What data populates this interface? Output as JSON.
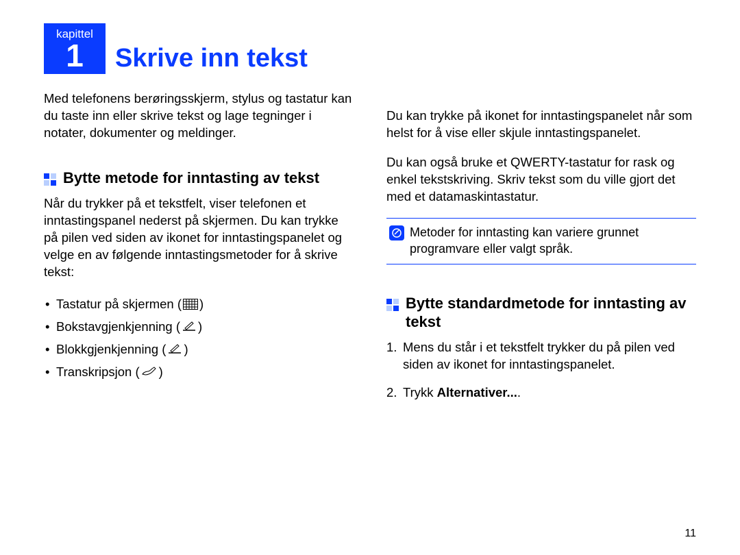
{
  "chapter": {
    "label": "kapittel",
    "number": "1",
    "title": "Skrive inn tekst"
  },
  "intro": "Med telefonens berøringsskjerm, stylus og tastatur kan du taste inn eller skrive tekst og lage tegninger i notater, dokumenter og meldinger.",
  "section1": {
    "title": "Bytte metode for inntasting av tekst",
    "body": "Når du trykker på et tekstfelt, viser telefonen et inntastingspanel nederst på skjermen. Du kan trykke på pilen ved siden av ikonet for inntastingspanelet og velge en av følgende inntastingsmetoder for å skrive tekst:",
    "items": [
      {
        "label": "Tastatur på skjermen (",
        "icon": "keyboard",
        "close": ")"
      },
      {
        "label": "Bokstavgjenkjenning (",
        "icon": "pen",
        "close": ")"
      },
      {
        "label": "Blokkgjenkjenning (",
        "icon": "pen",
        "close": ")"
      },
      {
        "label": "Transkripsjon (",
        "icon": "hand",
        "close": ")"
      }
    ]
  },
  "col2": {
    "p1": "Du kan trykke på ikonet for inntastingspanelet når som helst for å vise eller skjule inntastingspanelet.",
    "p2": "Du kan også bruke et QWERTY-tastatur for rask og enkel tekstskriving. Skriv tekst som du ville gjort det med et datamaskintastatur.",
    "note": "Metoder for inntasting kan variere grunnet programvare eller valgt språk."
  },
  "section2": {
    "title": "Bytte standardmetode for inntasting av tekst",
    "steps": [
      {
        "text": "Mens du står i et tekstfelt trykker du på pilen ved siden av ikonet for inntastingspanelet."
      },
      {
        "prefix": "Trykk ",
        "bold": "Alternativer...",
        "suffix": "."
      }
    ]
  },
  "pageNumber": "11"
}
